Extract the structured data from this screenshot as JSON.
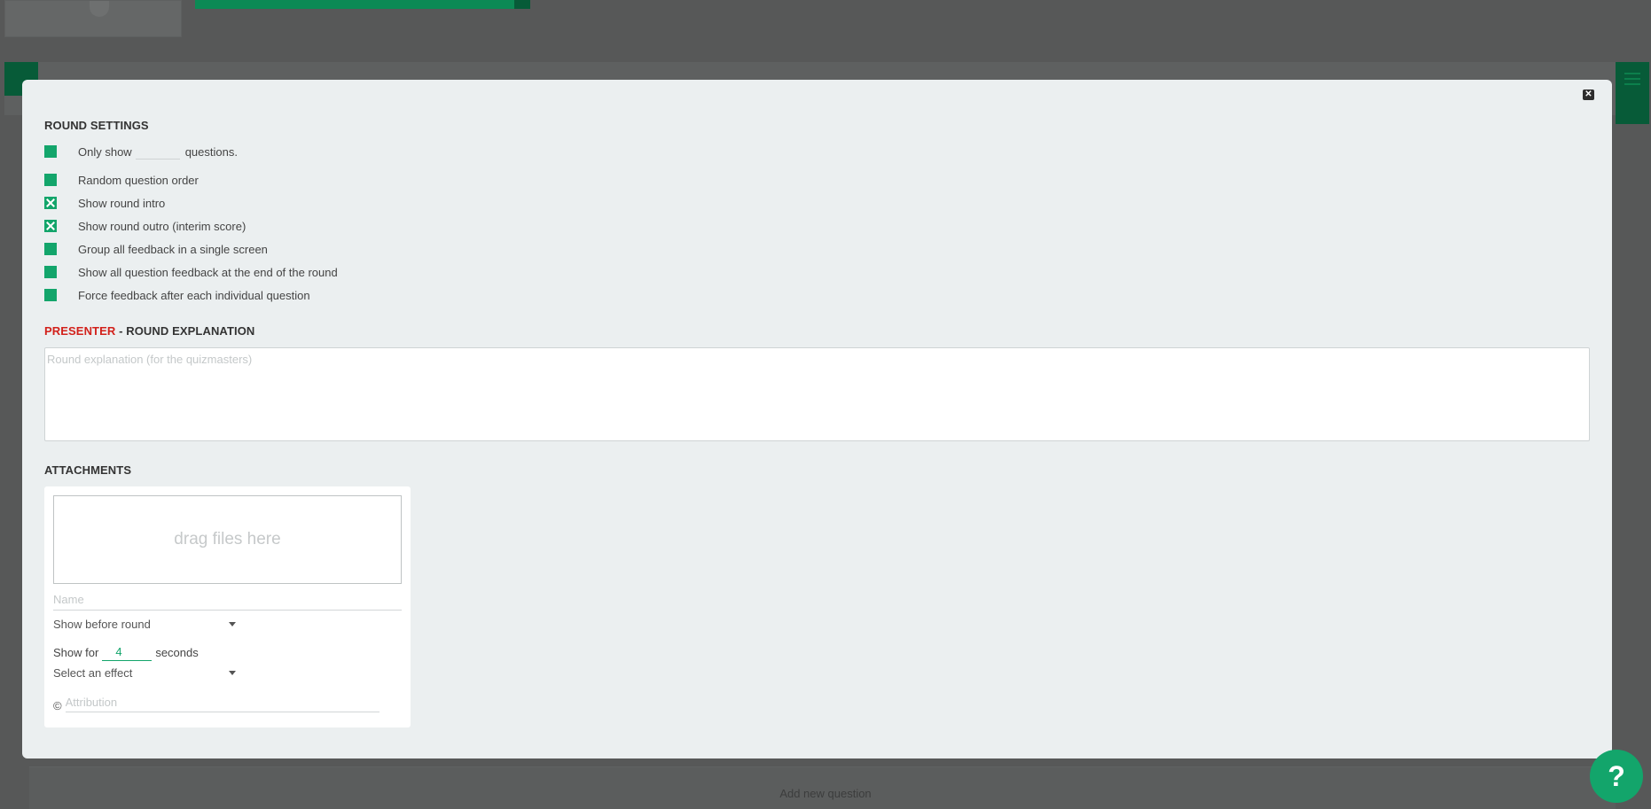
{
  "background": {
    "add_question_label": "Add new question"
  },
  "modal": {
    "close_icon": "close-x-icon",
    "round_settings": {
      "title": "ROUND SETTINGS",
      "only_show_prefix": "Only show",
      "only_show_value": "",
      "only_show_suffix": "questions.",
      "options": [
        {
          "label": "Random question order",
          "checked": false
        },
        {
          "label": "Show round intro",
          "checked": true
        },
        {
          "label": "Show round outro (interim score)",
          "checked": true
        },
        {
          "label": "Group all feedback in a single screen",
          "checked": false
        },
        {
          "label": "Show all question feedback at the end of the round",
          "checked": false
        },
        {
          "label": "Force feedback after each individual question",
          "checked": false
        }
      ]
    },
    "presenter": {
      "title_red": "PRESENTER",
      "title_rest": " - ROUND EXPLANATION",
      "placeholder": "Round explanation (for the quizmasters)",
      "value": ""
    },
    "attachments": {
      "title": "ATTACHMENTS",
      "dropzone_text": "drag files here",
      "name_placeholder": "Name",
      "show_when": "Show before round",
      "show_for_prefix": "Show for",
      "show_for_value": "4",
      "show_for_suffix": "seconds",
      "effect_placeholder": "Select an effect",
      "copyright_symbol": "©",
      "attribution_placeholder": "Attribution"
    }
  },
  "help": {
    "label": "?"
  },
  "colors": {
    "accent": "#13a56b",
    "presenter_red": "#d2211b",
    "overlay": "#575858"
  }
}
